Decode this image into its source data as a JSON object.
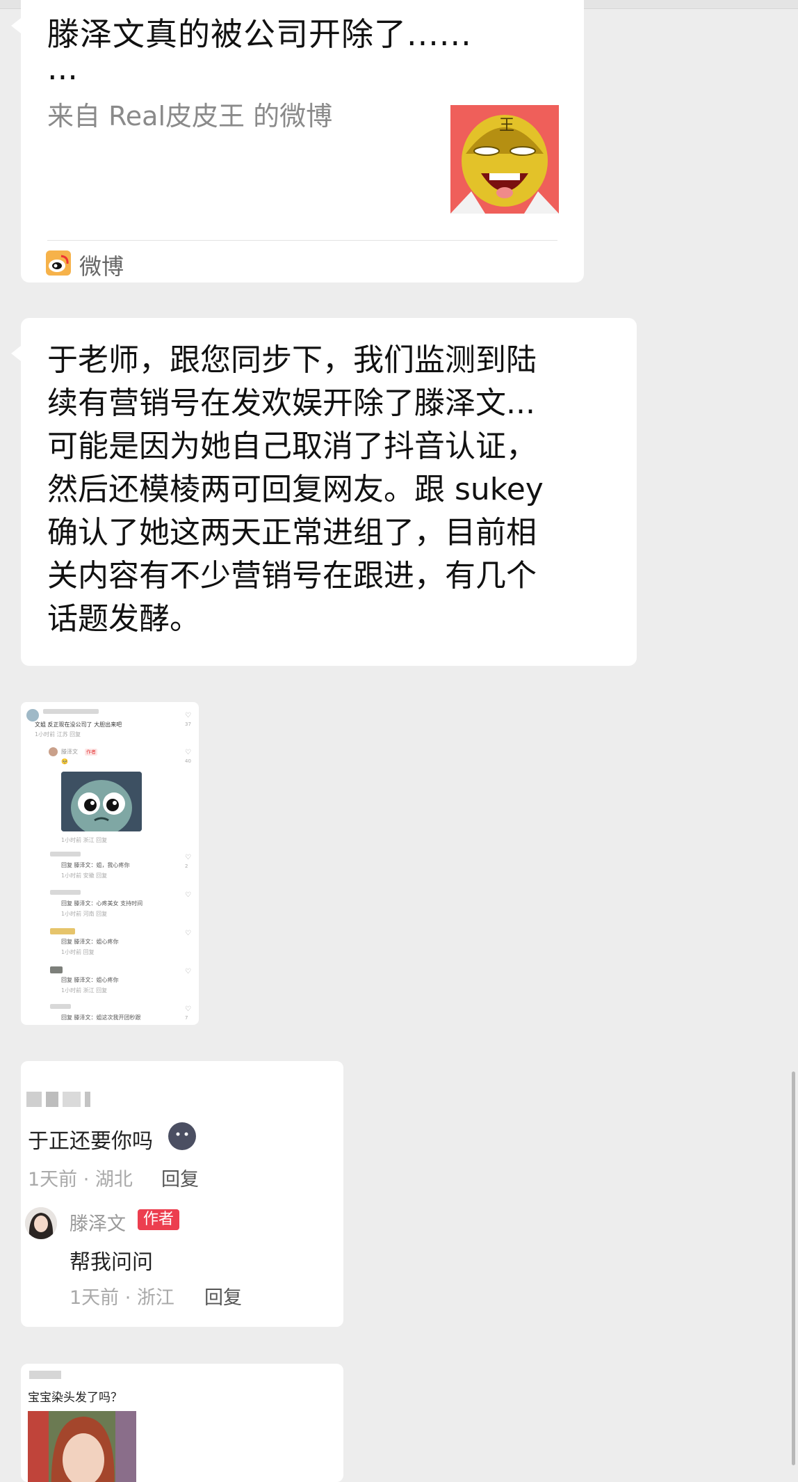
{
  "weibo_card": {
    "title": "滕泽文真的被公司开除了......",
    "title_cont": "...",
    "source": "来自 Real皮皮王 的微博",
    "footer_label": "微博"
  },
  "message": {
    "text": "于老师，跟您同步下，我们监测到陆\n续有营销号在发欢娱开除了滕泽文...\n可能是因为她自己取消了抖音认证，\n然后还模棱两可回复网友。跟 sukey\n确认了她这两天正常进组了，目前相\n关内容有不少营销号在跟进，有几个\n话题发酵。"
  },
  "screenshot1": {
    "top_comment": "文姐 反正现在没公司了 大胆出来吧",
    "top_meta": "1小时前 江苏 回复",
    "top_likes": "37",
    "author_name": "滕泽文",
    "author_tag": "作者",
    "author_likes": "40",
    "author_meta": "1小时前 浙江 回复",
    "replies": [
      {
        "text": "回复 滕泽文：姐，我心疼你",
        "meta": "1小时前 安徽 回复",
        "likes": "2"
      },
      {
        "text": "回复 滕泽文：心疼美女 支持时间",
        "meta": "1小时前 河南 回复",
        "likes": ""
      },
      {
        "text": "回复 滕泽文：姐心疼你",
        "meta": "1小时前 回复",
        "likes": ""
      },
      {
        "text": "回复 滕泽文：姐心疼你",
        "meta": "1小时前 浙江 回复",
        "likes": ""
      },
      {
        "text": "回复 滕泽文：姐这次我开团秒跟",
        "meta": "",
        "likes": "7"
      }
    ]
  },
  "comment_card": {
    "comment": "于正还要你吗",
    "meta": "1天前 · 湖北",
    "reply_label": "回复",
    "author_name": "滕泽文",
    "author_badge": "作者",
    "author_reply": "帮我问问",
    "author_meta": "1天前 · 浙江",
    "author_reply_label": "回复"
  },
  "screenshot3": {
    "text": "宝宝染头发了吗？"
  },
  "colors": {
    "background": "#ededed",
    "bubble": "#ffffff",
    "badge_red": "#ec3e4f",
    "meta_gray": "#a9a9a9"
  }
}
